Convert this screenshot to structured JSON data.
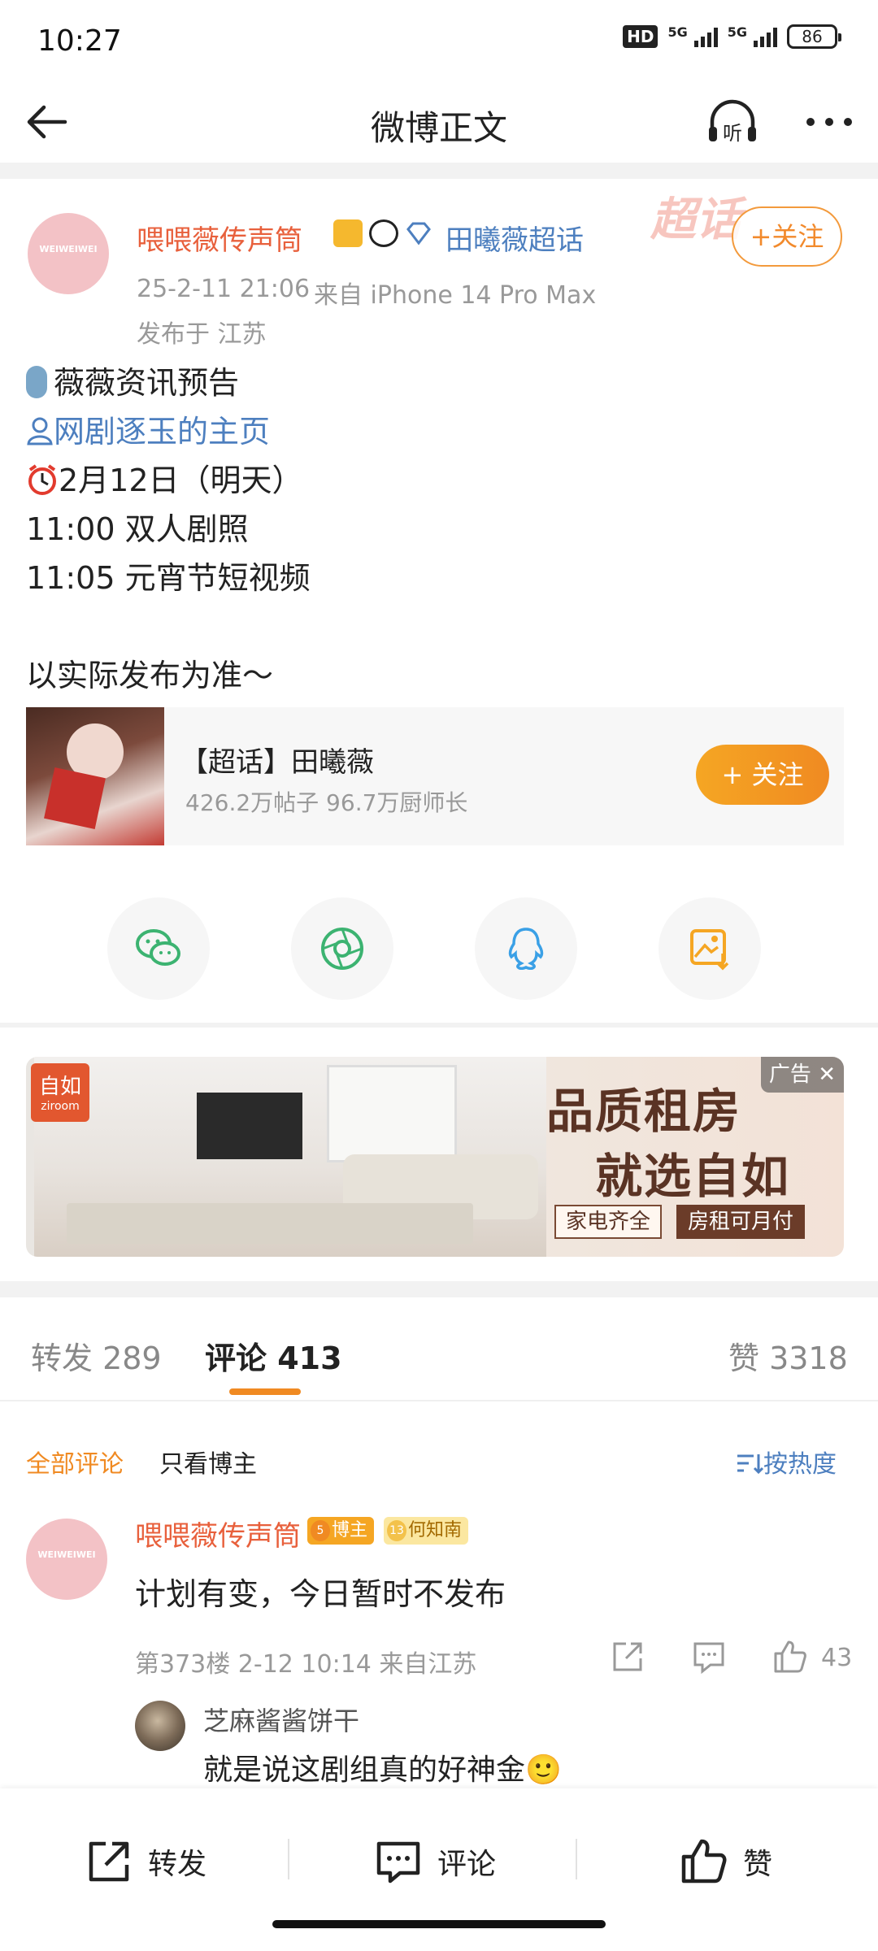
{
  "status_bar": {
    "time": "10:27",
    "hd": "HD",
    "network": [
      "5G",
      "5G"
    ],
    "battery": "86"
  },
  "nav": {
    "title": "微博正文",
    "listen_label": "听"
  },
  "post": {
    "author": "喂喂薇传声筒",
    "author_badges": [
      "crown-icon",
      "panda-icon",
      "diamond-icon"
    ],
    "super_topic_link": "田曦薇超话",
    "avatar_text": "WEIWEIWEI",
    "follow_label": "+关注",
    "time": "25-2-11 21:06",
    "source": "来自 iPhone 14 Pro Max",
    "location": "发布于 江苏",
    "background_mark": "超话",
    "lines": [
      {
        "icon": "microphone-icon",
        "text": "薇薇资讯预告"
      },
      {
        "icon": "person-icon",
        "text": "网剧逐玉的主页"
      },
      {
        "icon": "alarm-clock-icon",
        "text": "2月12日（明天）"
      },
      {
        "icon": "",
        "text": "11:00   双人剧照"
      },
      {
        "icon": "",
        "text": "11:05   元宵节短视频"
      },
      {
        "icon": "",
        "text": "以实际发布为准～"
      }
    ]
  },
  "topic_card": {
    "name": "【超话】田曦薇",
    "stats": "426.2万帖子 96.7万厨师长",
    "follow_label": "+ 关注"
  },
  "share": [
    "wechat-icon",
    "moments-icon",
    "qq-icon",
    "save-image-icon"
  ],
  "ad": {
    "label": "广告",
    "brand": "自如",
    "brand_en": "ziroom",
    "headline1": "品质租房",
    "headline2": "就选自如",
    "tag1": "家电齐全",
    "tag2": "房租可月付"
  },
  "tabs": {
    "repost": "转发 289",
    "comments": "评论 413",
    "likes": "赞 3318"
  },
  "filters": {
    "all": "全部评论",
    "author_only": "只看博主",
    "sort": "按热度"
  },
  "comment": {
    "author": "喂喂薇传声筒",
    "badge_host": "博主",
    "badge_host_level": "5",
    "badge_fan": "何知南",
    "badge_fan_level": "13",
    "text": "计划有变，今日暂时不发布",
    "meta": "第373楼 2-12 10:14 来自江苏",
    "likes": "43",
    "reply": {
      "author": "芝麻酱酱饼干",
      "text": "就是说这剧组真的好神金🙂"
    }
  },
  "toolbar": {
    "repost": "转发",
    "comment": "评论",
    "like": "赞"
  },
  "colors": {
    "accent": "#f08a22",
    "link": "#4d7fbf",
    "username": "#e8603c"
  }
}
